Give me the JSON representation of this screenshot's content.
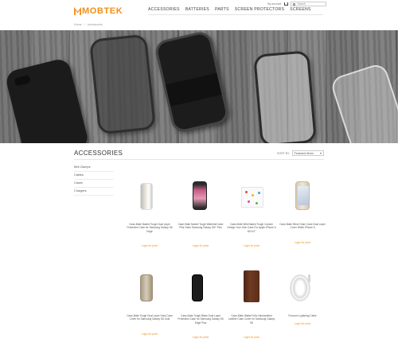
{
  "header": {
    "logo_text": "MOBTEK",
    "account_text": "My account",
    "search_placeholder": "Search",
    "nav": [
      "ACCESSORIES",
      "BATTERIES",
      "PARTS",
      "SCREEN PROTECTORS",
      "SCREENS"
    ]
  },
  "breadcrumb": [
    "Home",
    "/",
    "Accessories"
  ],
  "category": {
    "title": "ACCESSORIES",
    "sort_label": "SORT BY",
    "sort_value": "Featured Items"
  },
  "sidebar": {
    "items": [
      "Belt Clamps",
      "Cables",
      "Cases",
      "Chargers"
    ]
  },
  "products": [
    {
      "name": "Case-Mate Naked Tough Dual Layer Protective Case for Samsung Galaxy S6 Edge",
      "price": "Login for price"
    },
    {
      "name": "Case-Mate Naked Tough Waterfall Case Pink Glam Samsung Galaxy S6+ Plus",
      "price": "Login for price"
    },
    {
      "name": "Case-Mate Wild Naked Tough Custom Design Your Own Case For Apple iPhone 6 6S 6.0\"",
      "price": "Login for price"
    },
    {
      "name": "Case-Mate Silver Glam Case Dual Layer Cover White iPhone 6",
      "price": "Login for price"
    },
    {
      "name": "Case-Mate Tough Dual Layer Hard Case Cover for Samsung Galaxy S6 Gold",
      "price": "Login for price"
    },
    {
      "name": "Case-Mate Tough Black Dual Layer Protection Case for Samsung Galaxy S6 Edge Plus",
      "price": "Login for price"
    },
    {
      "name": "Case-Mate Wallet Folio Handcrafted Leather Case Cover for Samsung Galaxy S6",
      "price": "Login for price"
    },
    {
      "name": "Foxconn Lightning Cable",
      "price": "Login for price"
    }
  ],
  "colors": {
    "brand": "#f0901a",
    "text": "#333333"
  }
}
